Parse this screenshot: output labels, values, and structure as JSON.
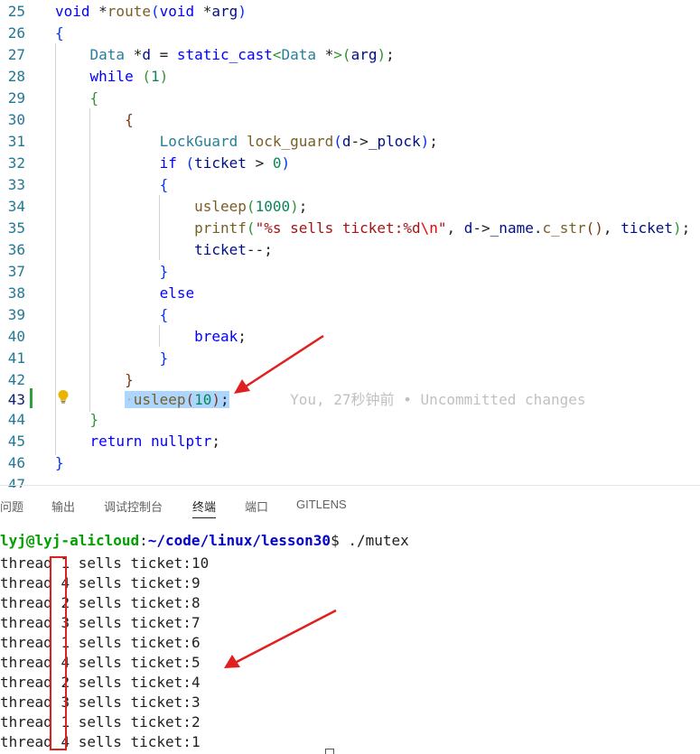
{
  "editor": {
    "lines": [
      {
        "n": "25"
      },
      {
        "n": "26"
      },
      {
        "n": "27"
      },
      {
        "n": "28"
      },
      {
        "n": "29"
      },
      {
        "n": "30"
      },
      {
        "n": "31"
      },
      {
        "n": "32"
      },
      {
        "n": "33"
      },
      {
        "n": "34"
      },
      {
        "n": "35"
      },
      {
        "n": "36"
      },
      {
        "n": "37"
      },
      {
        "n": "38"
      },
      {
        "n": "39"
      },
      {
        "n": "40"
      },
      {
        "n": "41"
      },
      {
        "n": "42"
      },
      {
        "n": "43"
      },
      {
        "n": "44"
      },
      {
        "n": "45"
      },
      {
        "n": "46"
      },
      {
        "n": "47"
      }
    ],
    "blame_text": "You, 27秒钟前 • Uncommitted changes"
  },
  "panel": {
    "tabs": [
      "问题",
      "输出",
      "调试控制台",
      "终端",
      "端口",
      "GITLENS"
    ],
    "active_tab": "终端"
  },
  "terminal": {
    "prompt_user": "lyj@lyj-alicloud",
    "prompt_sep": ":",
    "prompt_path": "~/code/linux/lesson30",
    "prompt_symbol": "$ ",
    "command": "./mutex",
    "output": [
      {
        "prefix": "thread ",
        "id": "1",
        "suffix": " sells ticket:10"
      },
      {
        "prefix": "thread ",
        "id": "4",
        "suffix": " sells ticket:9"
      },
      {
        "prefix": "thread ",
        "id": "2",
        "suffix": " sells ticket:8"
      },
      {
        "prefix": "thread ",
        "id": "3",
        "suffix": " sells ticket:7"
      },
      {
        "prefix": "thread ",
        "id": "1",
        "suffix": " sells ticket:6"
      },
      {
        "prefix": "thread ",
        "id": "4",
        "suffix": " sells ticket:5"
      },
      {
        "prefix": "thread ",
        "id": "2",
        "suffix": " sells ticket:4"
      },
      {
        "prefix": "thread ",
        "id": "3",
        "suffix": " sells ticket:3"
      },
      {
        "prefix": "thread ",
        "id": "1",
        "suffix": " sells ticket:2"
      },
      {
        "prefix": "thread ",
        "id": "4",
        "suffix": " sells ticket:1"
      }
    ]
  },
  "colors": {
    "annotation_red": "#e02020",
    "selection": "#add6ff",
    "added_line_marker": "#2ea043"
  },
  "icons": [
    "lightbulb-icon",
    "arrow-annotation"
  ]
}
